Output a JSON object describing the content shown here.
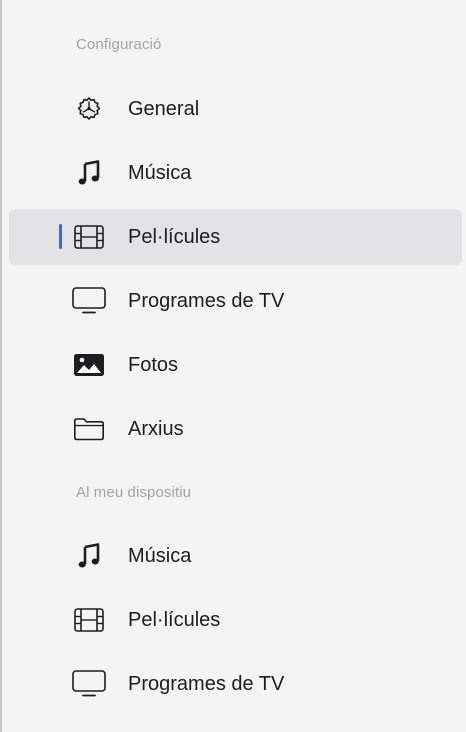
{
  "sections": [
    {
      "header": "Configuració",
      "items": [
        {
          "label": "General",
          "icon": "gear-icon"
        },
        {
          "label": "Música",
          "icon": "music-note-icon"
        },
        {
          "label": "Pel·lícules",
          "icon": "film-icon",
          "selected": true
        },
        {
          "label": "Programes de TV",
          "icon": "tv-icon"
        },
        {
          "label": "Fotos",
          "icon": "photo-icon"
        },
        {
          "label": "Arxius",
          "icon": "folder-icon"
        }
      ]
    },
    {
      "header": "Al meu dispositiu",
      "items": [
        {
          "label": "Música",
          "icon": "music-note-icon"
        },
        {
          "label": "Pel·lícules",
          "icon": "film-icon"
        },
        {
          "label": "Programes de TV",
          "icon": "tv-icon"
        }
      ]
    }
  ],
  "colors": {
    "selection_indicator": "#2b6cf0",
    "selected_background": "#e3e3e5",
    "sidebar_background": "#f4f4f5",
    "section_header": "#a3a3a6"
  }
}
